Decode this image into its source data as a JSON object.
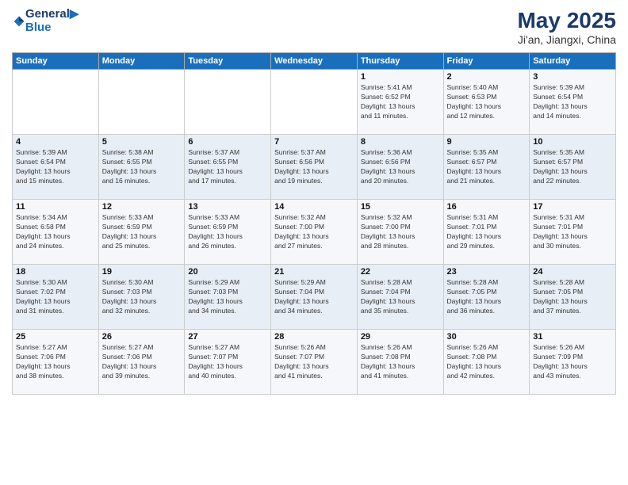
{
  "logo": {
    "line1": "General",
    "line2": "Blue"
  },
  "title": {
    "month_year": "May 2025",
    "location": "Ji'an, Jiangxi, China"
  },
  "days_of_week": [
    "Sunday",
    "Monday",
    "Tuesday",
    "Wednesday",
    "Thursday",
    "Friday",
    "Saturday"
  ],
  "weeks": [
    [
      {
        "day": "",
        "content": ""
      },
      {
        "day": "",
        "content": ""
      },
      {
        "day": "",
        "content": ""
      },
      {
        "day": "",
        "content": ""
      },
      {
        "day": "1",
        "content": "Sunrise: 5:41 AM\nSunset: 6:52 PM\nDaylight: 13 hours\nand 11 minutes."
      },
      {
        "day": "2",
        "content": "Sunrise: 5:40 AM\nSunset: 6:53 PM\nDaylight: 13 hours\nand 12 minutes."
      },
      {
        "day": "3",
        "content": "Sunrise: 5:39 AM\nSunset: 6:54 PM\nDaylight: 13 hours\nand 14 minutes."
      }
    ],
    [
      {
        "day": "4",
        "content": "Sunrise: 5:39 AM\nSunset: 6:54 PM\nDaylight: 13 hours\nand 15 minutes."
      },
      {
        "day": "5",
        "content": "Sunrise: 5:38 AM\nSunset: 6:55 PM\nDaylight: 13 hours\nand 16 minutes."
      },
      {
        "day": "6",
        "content": "Sunrise: 5:37 AM\nSunset: 6:55 PM\nDaylight: 13 hours\nand 17 minutes."
      },
      {
        "day": "7",
        "content": "Sunrise: 5:37 AM\nSunset: 6:56 PM\nDaylight: 13 hours\nand 19 minutes."
      },
      {
        "day": "8",
        "content": "Sunrise: 5:36 AM\nSunset: 6:56 PM\nDaylight: 13 hours\nand 20 minutes."
      },
      {
        "day": "9",
        "content": "Sunrise: 5:35 AM\nSunset: 6:57 PM\nDaylight: 13 hours\nand 21 minutes."
      },
      {
        "day": "10",
        "content": "Sunrise: 5:35 AM\nSunset: 6:57 PM\nDaylight: 13 hours\nand 22 minutes."
      }
    ],
    [
      {
        "day": "11",
        "content": "Sunrise: 5:34 AM\nSunset: 6:58 PM\nDaylight: 13 hours\nand 24 minutes."
      },
      {
        "day": "12",
        "content": "Sunrise: 5:33 AM\nSunset: 6:59 PM\nDaylight: 13 hours\nand 25 minutes."
      },
      {
        "day": "13",
        "content": "Sunrise: 5:33 AM\nSunset: 6:59 PM\nDaylight: 13 hours\nand 26 minutes."
      },
      {
        "day": "14",
        "content": "Sunrise: 5:32 AM\nSunset: 7:00 PM\nDaylight: 13 hours\nand 27 minutes."
      },
      {
        "day": "15",
        "content": "Sunrise: 5:32 AM\nSunset: 7:00 PM\nDaylight: 13 hours\nand 28 minutes."
      },
      {
        "day": "16",
        "content": "Sunrise: 5:31 AM\nSunset: 7:01 PM\nDaylight: 13 hours\nand 29 minutes."
      },
      {
        "day": "17",
        "content": "Sunrise: 5:31 AM\nSunset: 7:01 PM\nDaylight: 13 hours\nand 30 minutes."
      }
    ],
    [
      {
        "day": "18",
        "content": "Sunrise: 5:30 AM\nSunset: 7:02 PM\nDaylight: 13 hours\nand 31 minutes."
      },
      {
        "day": "19",
        "content": "Sunrise: 5:30 AM\nSunset: 7:03 PM\nDaylight: 13 hours\nand 32 minutes."
      },
      {
        "day": "20",
        "content": "Sunrise: 5:29 AM\nSunset: 7:03 PM\nDaylight: 13 hours\nand 34 minutes."
      },
      {
        "day": "21",
        "content": "Sunrise: 5:29 AM\nSunset: 7:04 PM\nDaylight: 13 hours\nand 34 minutes."
      },
      {
        "day": "22",
        "content": "Sunrise: 5:28 AM\nSunset: 7:04 PM\nDaylight: 13 hours\nand 35 minutes."
      },
      {
        "day": "23",
        "content": "Sunrise: 5:28 AM\nSunset: 7:05 PM\nDaylight: 13 hours\nand 36 minutes."
      },
      {
        "day": "24",
        "content": "Sunrise: 5:28 AM\nSunset: 7:05 PM\nDaylight: 13 hours\nand 37 minutes."
      }
    ],
    [
      {
        "day": "25",
        "content": "Sunrise: 5:27 AM\nSunset: 7:06 PM\nDaylight: 13 hours\nand 38 minutes."
      },
      {
        "day": "26",
        "content": "Sunrise: 5:27 AM\nSunset: 7:06 PM\nDaylight: 13 hours\nand 39 minutes."
      },
      {
        "day": "27",
        "content": "Sunrise: 5:27 AM\nSunset: 7:07 PM\nDaylight: 13 hours\nand 40 minutes."
      },
      {
        "day": "28",
        "content": "Sunrise: 5:26 AM\nSunset: 7:07 PM\nDaylight: 13 hours\nand 41 minutes."
      },
      {
        "day": "29",
        "content": "Sunrise: 5:26 AM\nSunset: 7:08 PM\nDaylight: 13 hours\nand 41 minutes."
      },
      {
        "day": "30",
        "content": "Sunrise: 5:26 AM\nSunset: 7:08 PM\nDaylight: 13 hours\nand 42 minutes."
      },
      {
        "day": "31",
        "content": "Sunrise: 5:26 AM\nSunset: 7:09 PM\nDaylight: 13 hours\nand 43 minutes."
      }
    ]
  ]
}
